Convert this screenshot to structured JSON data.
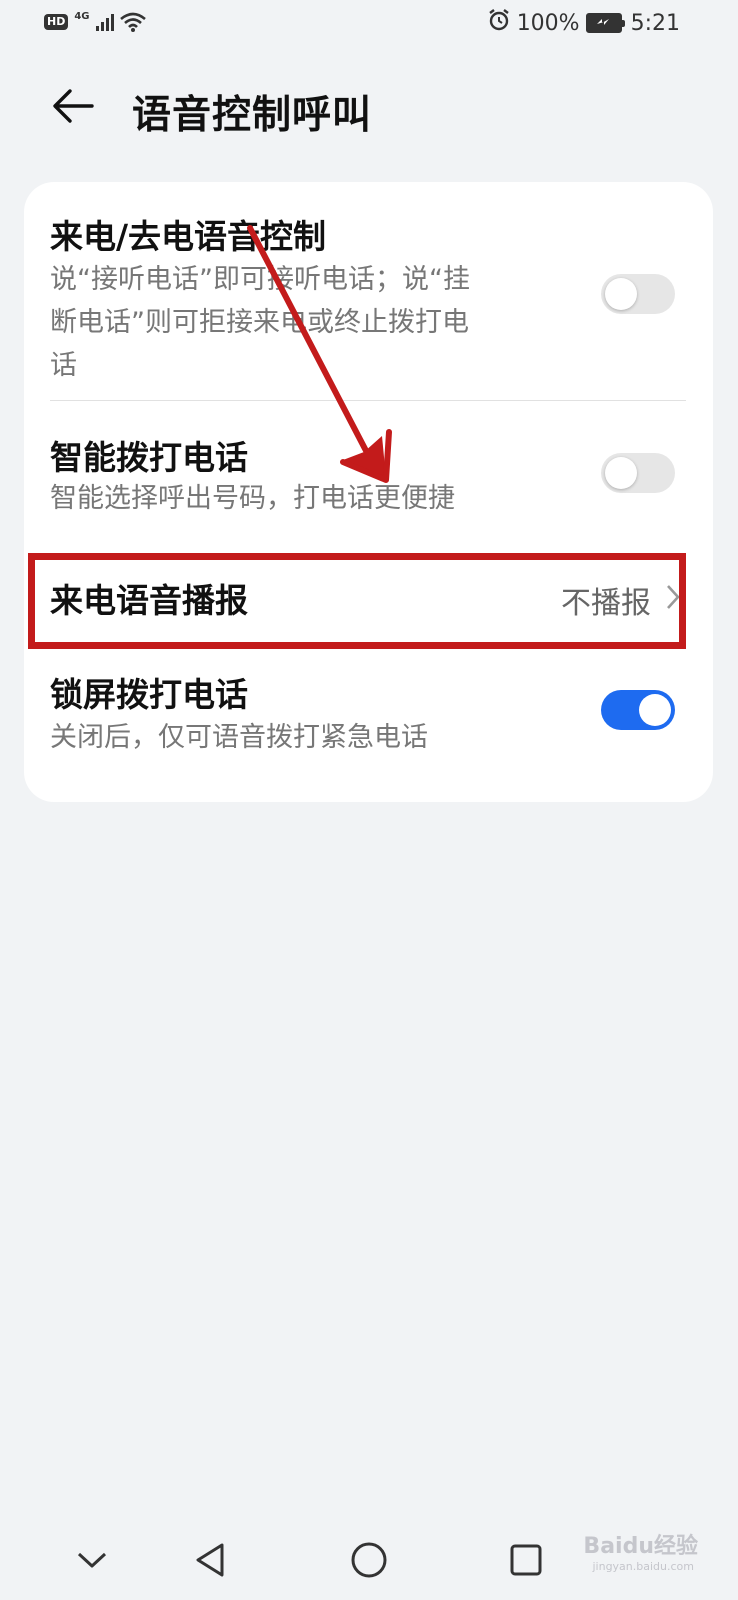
{
  "status_bar": {
    "hd": "HD",
    "network": "4G",
    "battery_percent": "100%",
    "time": "5:21",
    "icons": [
      "hd-icon",
      "signal-icon",
      "wifi-icon",
      "alarm-icon",
      "battery-charging-icon"
    ]
  },
  "header": {
    "title": "语音控制呼叫",
    "back_icon": "arrow-left-icon"
  },
  "settings": [
    {
      "title": "来电/去电语音控制",
      "subtitle_lines": [
        "说“接听电话”即可接听电话；说“挂",
        "断电话”则可拒接来电或终止拨打电",
        "话"
      ],
      "toggle_on": false
    },
    {
      "title": "智能拨打电话",
      "subtitle_lines": [
        "智能选择呼出号码，打电话更便捷"
      ],
      "toggle_on": false
    },
    {
      "title": "来电语音播报",
      "value": "不播报",
      "chevron_icon": "chevron-right-icon"
    },
    {
      "title": "锁屏拨打电话",
      "subtitle_lines": [
        "关闭后，仅可语音拨打紧急电话"
      ],
      "toggle_on": true
    }
  ],
  "annotation": {
    "highlight_color": "#c31b1b",
    "arrow_color": "#c31b1b"
  },
  "nav_bar": {
    "icons": [
      "collapse-down-icon",
      "back-triangle-icon",
      "home-circle-icon",
      "recents-square-icon"
    ]
  },
  "watermark": {
    "text": "Baidu经验",
    "sub": "jingyan.baidu.com"
  },
  "colors": {
    "background": "#f1f3f5",
    "card": "#ffffff",
    "toggle_on": "#1e6bf0",
    "toggle_off": "#e6e6e6"
  }
}
